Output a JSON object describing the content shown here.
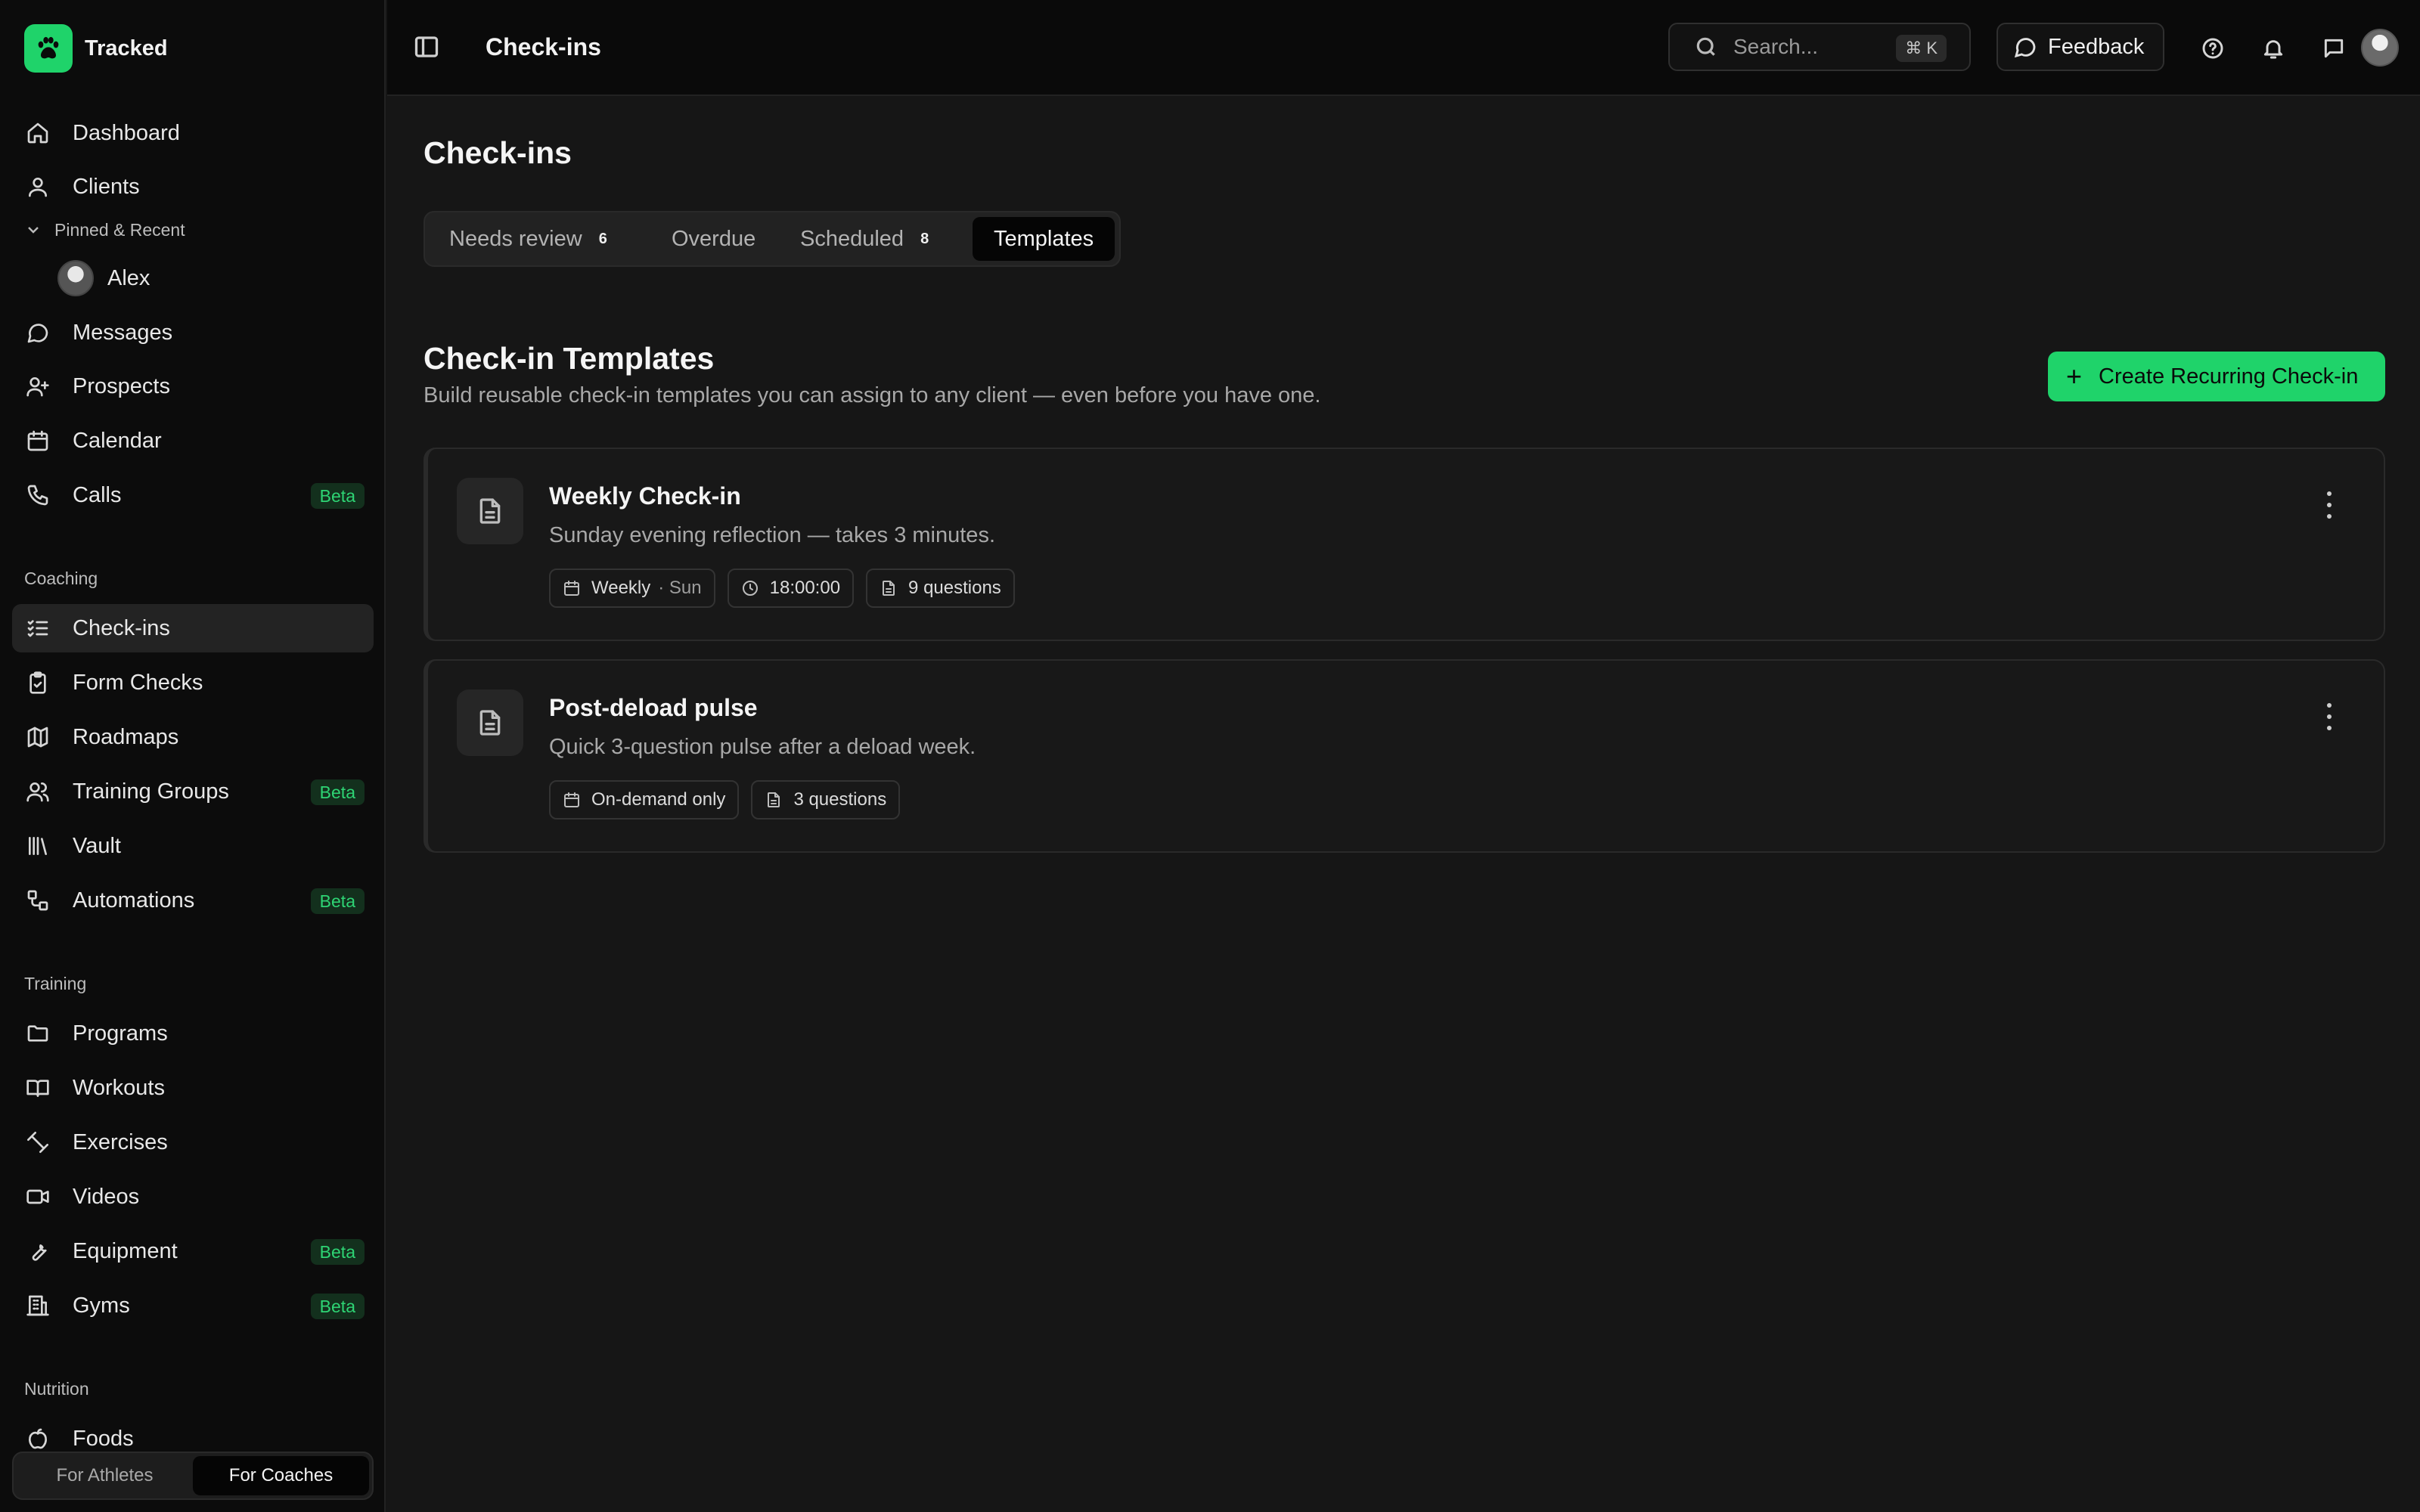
{
  "brand": {
    "name": "Tracked"
  },
  "sidebar": {
    "pinned_label": "Pinned & Recent",
    "pinned_items": [
      {
        "label": "Alex"
      }
    ],
    "top_items": [
      {
        "label": "Dashboard",
        "icon": "home-icon"
      },
      {
        "label": "Clients",
        "icon": "user-icon"
      },
      {
        "label": "Messages",
        "icon": "message-icon"
      },
      {
        "label": "Prospects",
        "icon": "user-plus-icon"
      },
      {
        "label": "Calendar",
        "icon": "calendar-icon"
      },
      {
        "label": "Calls",
        "icon": "phone-icon",
        "badge": "Beta"
      }
    ],
    "sections": [
      {
        "label": "Coaching",
        "items": [
          {
            "label": "Check-ins",
            "icon": "list-check-icon",
            "active": true
          },
          {
            "label": "Form Checks",
            "icon": "clipboard-check-icon"
          },
          {
            "label": "Roadmaps",
            "icon": "map-icon"
          },
          {
            "label": "Training Groups",
            "icon": "users-icon",
            "badge": "Beta"
          },
          {
            "label": "Vault",
            "icon": "library-icon"
          },
          {
            "label": "Automations",
            "icon": "workflow-icon",
            "badge": "Beta"
          }
        ]
      },
      {
        "label": "Training",
        "items": [
          {
            "label": "Programs",
            "icon": "folder-icon"
          },
          {
            "label": "Workouts",
            "icon": "book-icon"
          },
          {
            "label": "Exercises",
            "icon": "dumbbell-icon"
          },
          {
            "label": "Videos",
            "icon": "video-icon"
          },
          {
            "label": "Equipment",
            "icon": "wrench-icon",
            "badge": "Beta"
          },
          {
            "label": "Gyms",
            "icon": "building-icon",
            "badge": "Beta"
          }
        ]
      },
      {
        "label": "Nutrition",
        "items": [
          {
            "label": "Foods",
            "icon": "apple-icon"
          }
        ]
      }
    ],
    "role_toggle": {
      "athletes": "For Athletes",
      "coaches": "For Coaches",
      "selected": "For Coaches"
    }
  },
  "topbar": {
    "title": "Check-ins",
    "search_placeholder": "Search...",
    "search_shortcut": "⌘ K",
    "feedback_label": "Feedback"
  },
  "main": {
    "page_title": "Check-ins",
    "tabs": [
      {
        "label": "Needs review",
        "count": "6"
      },
      {
        "label": "Overdue",
        "count": ""
      },
      {
        "label": "Scheduled",
        "count": "8"
      },
      {
        "label": "Templates",
        "count": "",
        "active": true
      }
    ],
    "section_title": "Check-in Templates",
    "section_subtitle": "Build reusable check-in templates you can assign to any client — even before you have one.",
    "create_button": "Create Recurring Check-in",
    "templates": [
      {
        "title": "Weekly Check-in",
        "description": "Sunday evening reflection — takes 3 minutes.",
        "frequency": "Weekly",
        "day": "· Sun",
        "time": "18:00:00",
        "questions": "9 questions"
      },
      {
        "title": "Post-deload pulse",
        "description": "Quick 3-question pulse after a deload week.",
        "frequency": "On-demand only",
        "questions": "3 questions"
      }
    ]
  },
  "colors": {
    "accent": "#1fd36a",
    "background": "#161616",
    "sidebar": "#0c0c0c"
  }
}
